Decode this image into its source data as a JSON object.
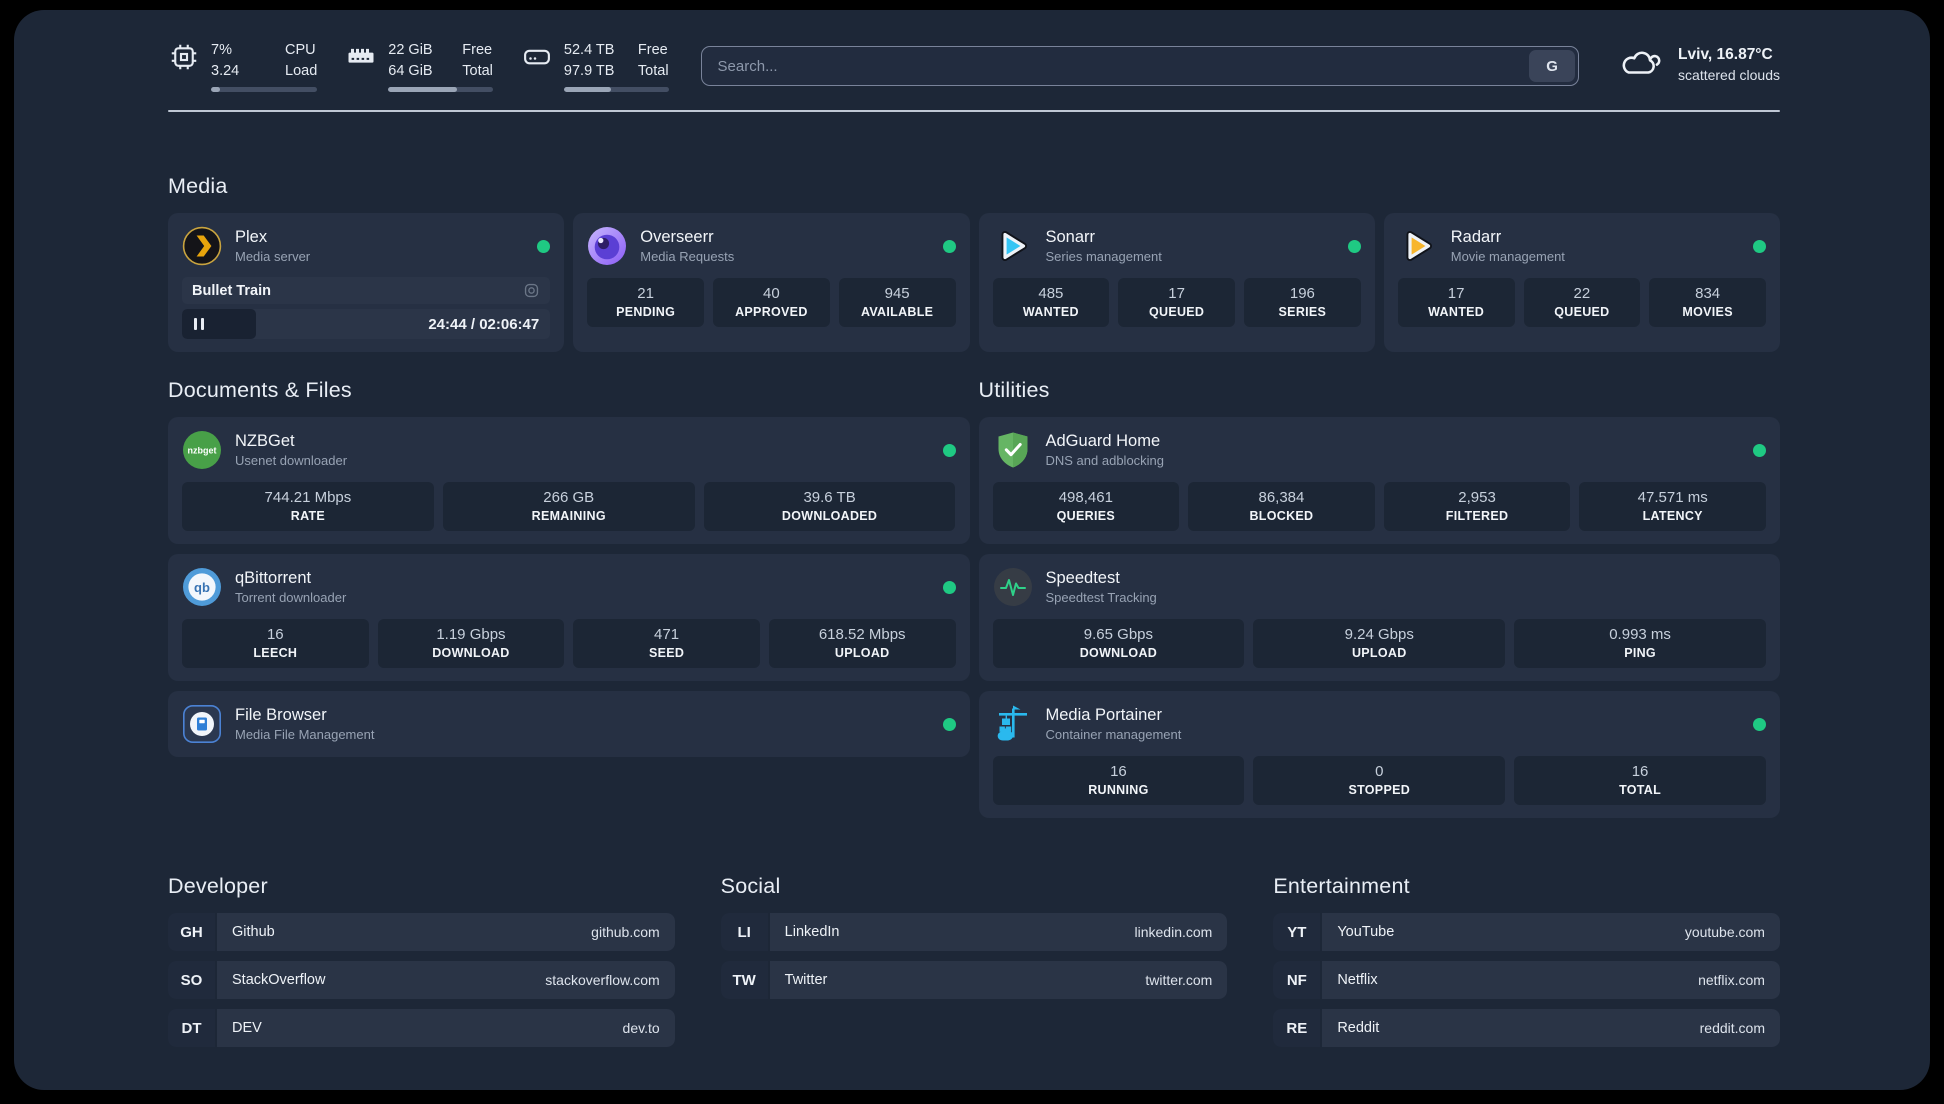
{
  "colors": {
    "background": "#1d2737",
    "card": "#263043",
    "stat_box": "#1c2635",
    "status_green": "#1fc983",
    "plex_yellow": "#e8a50c",
    "sonarr_blue": "#35c5f4",
    "radarr_yellow": "#f7b52c",
    "nzbget_green": "#48a048",
    "adguard_green": "#66b564",
    "qbittorrent_blue": "#4f9bd9",
    "speedtest_green": "#2fd189",
    "portainer_blue": "#2ab9ee",
    "filebrowser_blue": "#2f7fd6"
  },
  "header": {
    "cpu": {
      "icon": "cpu-icon",
      "values": [
        "7%",
        "3.24"
      ],
      "labels": [
        "CPU",
        "Load"
      ],
      "bar_percent": 8
    },
    "memory": {
      "icon": "ram-icon",
      "values": [
        "22 GiB",
        "64 GiB"
      ],
      "labels": [
        "Free",
        "Total"
      ],
      "bar_percent": 66
    },
    "disk": {
      "icon": "disk-icon",
      "values": [
        "52.4 TB",
        "97.9 TB"
      ],
      "labels": [
        "Free",
        "Total"
      ],
      "bar_percent": 45
    },
    "search": {
      "placeholder": "Search...",
      "provider_button": "G"
    },
    "weather": {
      "icon": "cloud-icon",
      "line1": "Lviv, 16.87°C",
      "line2": "scattered clouds"
    }
  },
  "app_sections": {
    "media": {
      "title": "Media",
      "cards": [
        {
          "name": "Plex",
          "subtitle": "Media server",
          "icon": "plex-icon",
          "status_dot": true,
          "player": {
            "title": "Bullet Train",
            "time": "24:44 / 02:06:47",
            "progress_percent": 20
          },
          "stats": []
        },
        {
          "name": "Overseerr",
          "subtitle": "Media Requests",
          "icon": "overseerr-icon",
          "status_dot": true,
          "stats": [
            {
              "value": "21",
              "label": "PENDING"
            },
            {
              "value": "40",
              "label": "APPROVED"
            },
            {
              "value": "945",
              "label": "AVAILABLE"
            }
          ]
        },
        {
          "name": "Sonarr",
          "subtitle": "Series management",
          "icon": "sonarr-icon",
          "status_dot": true,
          "stats": [
            {
              "value": "485",
              "label": "WANTED"
            },
            {
              "value": "17",
              "label": "QUEUED"
            },
            {
              "value": "196",
              "label": "SERIES"
            }
          ]
        },
        {
          "name": "Radarr",
          "subtitle": "Movie management",
          "icon": "radarr-icon",
          "status_dot": true,
          "stats": [
            {
              "value": "17",
              "label": "WANTED"
            },
            {
              "value": "22",
              "label": "QUEUED"
            },
            {
              "value": "834",
              "label": "MOVIES"
            }
          ]
        }
      ]
    },
    "documents": {
      "title": "Documents & Files",
      "cards": [
        {
          "name": "NZBGet",
          "subtitle": "Usenet downloader",
          "icon": "nzbget-icon",
          "status_dot": true,
          "stats": [
            {
              "value": "744.21 Mbps",
              "label": "RATE"
            },
            {
              "value": "266 GB",
              "label": "REMAINING"
            },
            {
              "value": "39.6 TB",
              "label": "DOWNLOADED"
            }
          ]
        },
        {
          "name": "qBittorrent",
          "subtitle": "Torrent downloader",
          "icon": "qbittorrent-icon",
          "status_dot": true,
          "stats": [
            {
              "value": "16",
              "label": "LEECH"
            },
            {
              "value": "1.19 Gbps",
              "label": "DOWNLOAD"
            },
            {
              "value": "471",
              "label": "SEED"
            },
            {
              "value": "618.52 Mbps",
              "label": "UPLOAD"
            }
          ]
        },
        {
          "name": "File Browser",
          "subtitle": "Media File Management",
          "icon": "filebrowser-icon",
          "status_dot": true,
          "stats": []
        }
      ]
    },
    "utilities": {
      "title": "Utilities",
      "cards": [
        {
          "name": "AdGuard Home",
          "subtitle": "DNS and adblocking",
          "icon": "adguard-icon",
          "status_dot": true,
          "stats": [
            {
              "value": "498,461",
              "label": "QUERIES"
            },
            {
              "value": "86,384",
              "label": "BLOCKED"
            },
            {
              "value": "2,953",
              "label": "FILTERED"
            },
            {
              "value": "47.571 ms",
              "label": "LATENCY"
            }
          ]
        },
        {
          "name": "Speedtest",
          "subtitle": "Speedtest Tracking",
          "icon": "speedtest-icon",
          "status_dot": false,
          "stats": [
            {
              "value": "9.65 Gbps",
              "label": "DOWNLOAD"
            },
            {
              "value": "9.24 Gbps",
              "label": "UPLOAD"
            },
            {
              "value": "0.993 ms",
              "label": "PING"
            }
          ]
        },
        {
          "name": "Media Portainer",
          "subtitle": "Container management",
          "icon": "portainer-icon",
          "status_dot": true,
          "stats": [
            {
              "value": "16",
              "label": "RUNNING"
            },
            {
              "value": "0",
              "label": "STOPPED"
            },
            {
              "value": "16",
              "label": "TOTAL"
            }
          ]
        }
      ]
    }
  },
  "link_sections": [
    {
      "title": "Developer",
      "links": [
        {
          "abbr": "GH",
          "name": "Github",
          "url": "github.com"
        },
        {
          "abbr": "SO",
          "name": "StackOverflow",
          "url": "stackoverflow.com"
        },
        {
          "abbr": "DT",
          "name": "DEV",
          "url": "dev.to"
        }
      ]
    },
    {
      "title": "Social",
      "links": [
        {
          "abbr": "LI",
          "name": "LinkedIn",
          "url": "linkedin.com"
        },
        {
          "abbr": "TW",
          "name": "Twitter",
          "url": "twitter.com"
        }
      ]
    },
    {
      "title": "Entertainment",
      "links": [
        {
          "abbr": "YT",
          "name": "YouTube",
          "url": "youtube.com"
        },
        {
          "abbr": "NF",
          "name": "Netflix",
          "url": "netflix.com"
        },
        {
          "abbr": "RE",
          "name": "Reddit",
          "url": "reddit.com"
        }
      ]
    }
  ]
}
